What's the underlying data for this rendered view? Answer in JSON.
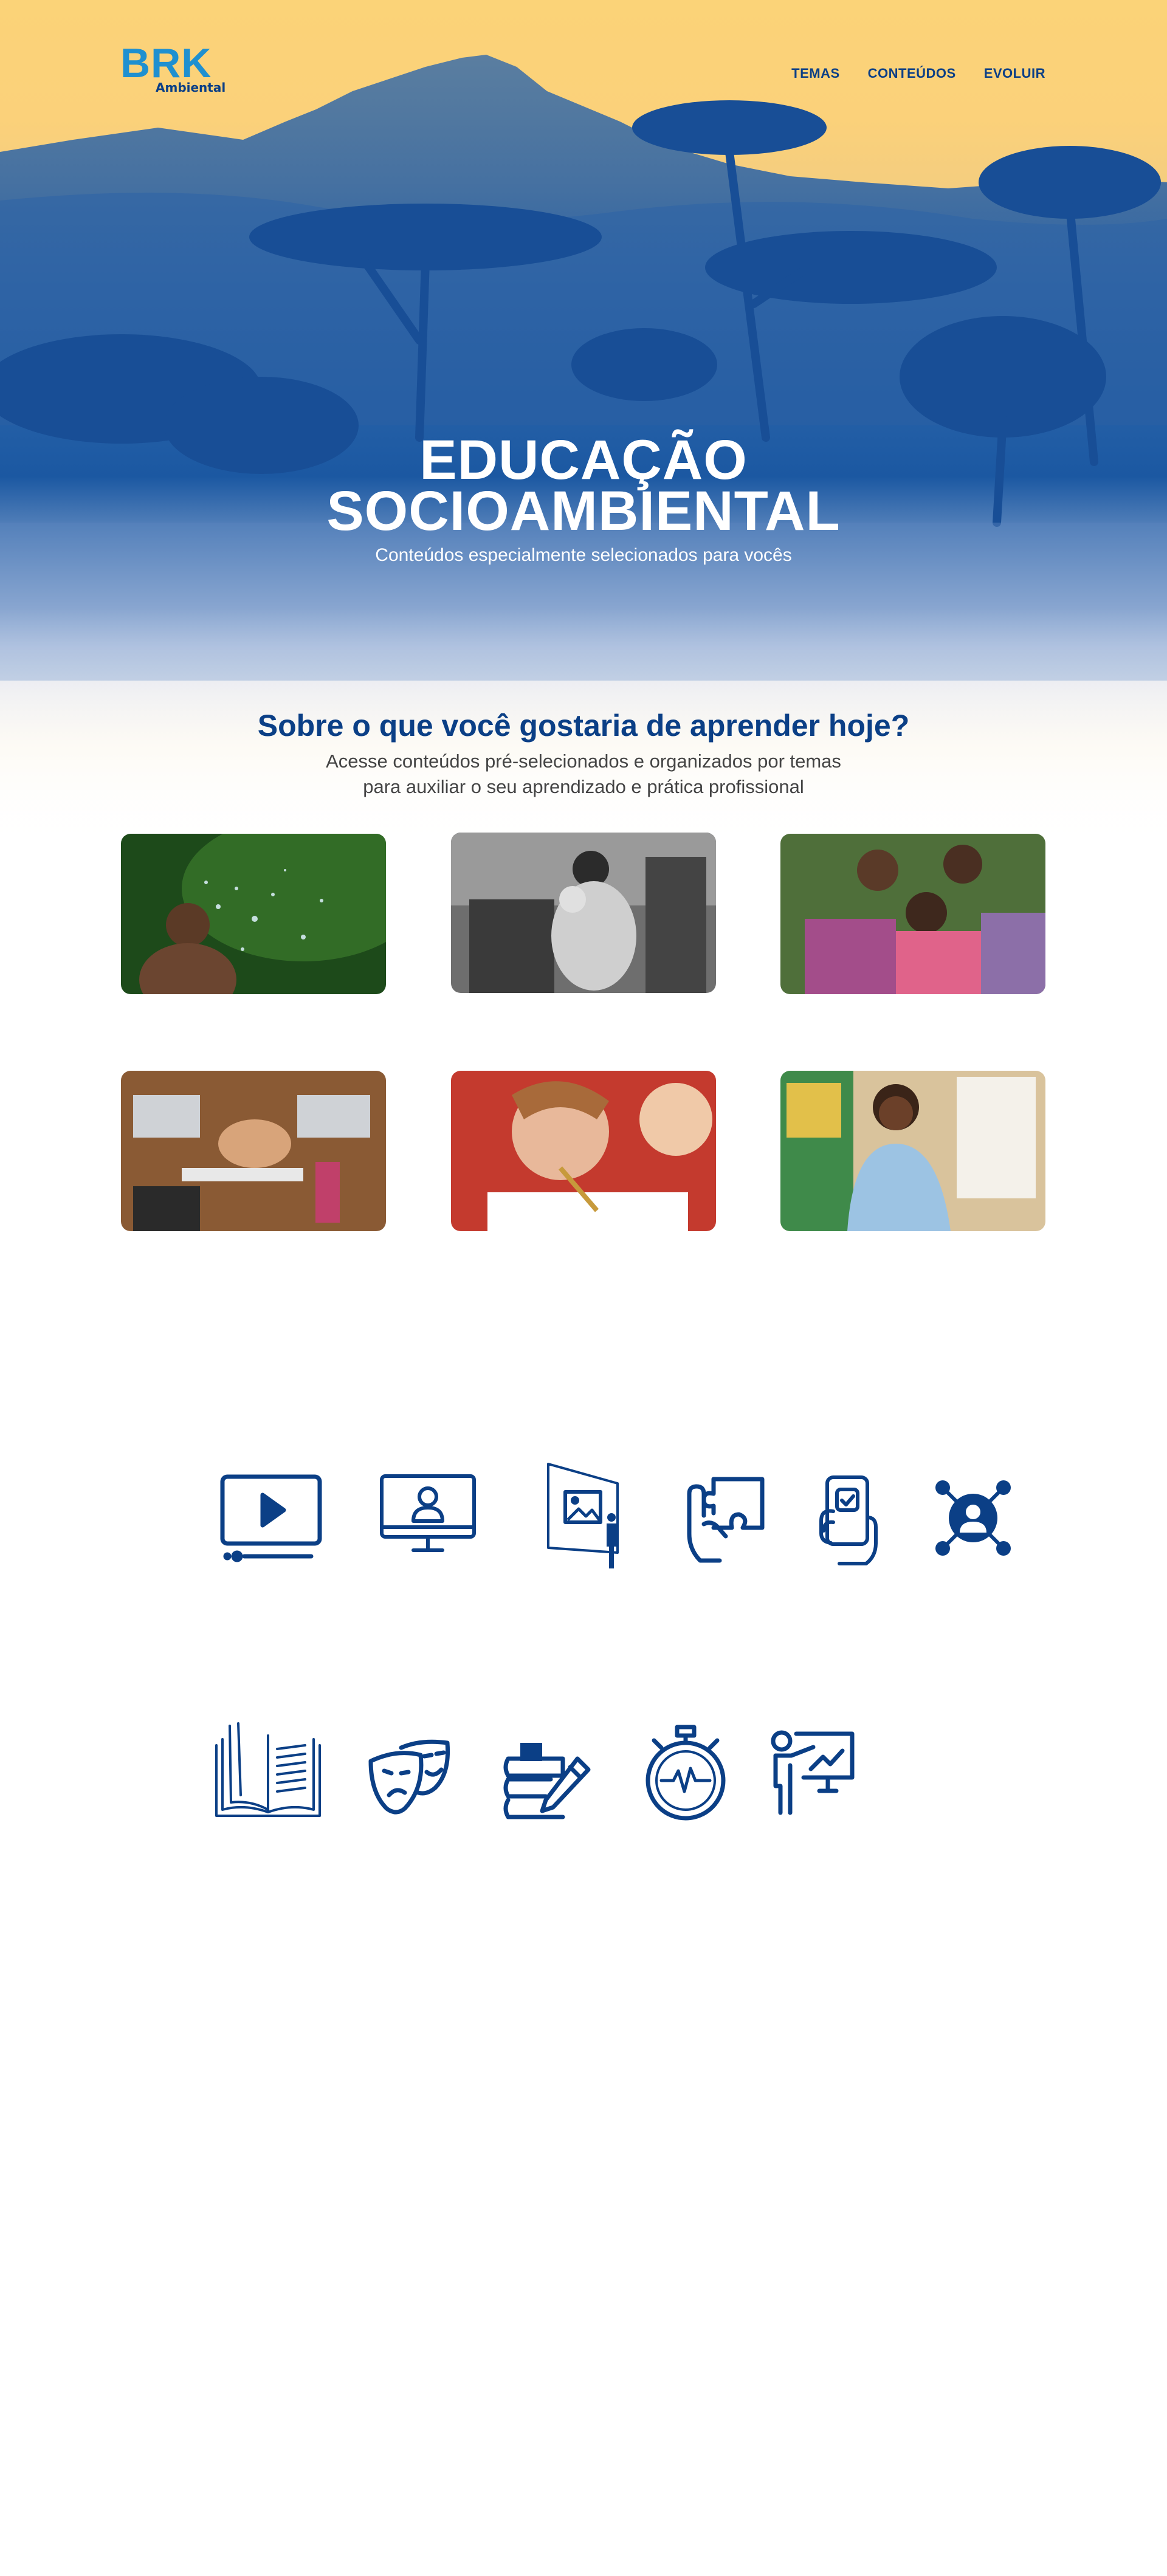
{
  "brand": {
    "logo_text": "BRK",
    "logo_sub": "Ambiental"
  },
  "nav": {
    "items": [
      {
        "label": "TEMAS"
      },
      {
        "label": "CONTEÚDOS"
      },
      {
        "label": "EVOLUIR"
      }
    ]
  },
  "hero": {
    "title_line1": "EDUCAÇÃO",
    "title_line2": "SOCIOAMBIENTAL",
    "subtitle": "Conteúdos especialmente selecionados para vocês"
  },
  "topics": {
    "title": "Sobre o que você gostaria de aprender hoje?",
    "subtitle_line1": "Acesse conteúdos pré-selecionados e organizados por temas",
    "subtitle_line2": "para auxiliar o seu aprendizado e prática profissional"
  },
  "cards": [
    {
      "image": "child-splashing-water"
    },
    {
      "image": "mother-child-washing-hands"
    },
    {
      "image": "children-hugging"
    },
    {
      "image": "team-hands-together-laptops"
    },
    {
      "image": "children-drawing"
    },
    {
      "image": "teacher-at-whiteboard"
    }
  ],
  "content_icons_row1": [
    "video-player-icon",
    "online-class-icon",
    "exhibition-icon",
    "puzzle-touch-icon",
    "mobile-check-icon",
    "network-user-icon"
  ],
  "content_icons_row2": [
    "open-book-icon",
    "theater-masks-icon",
    "books-pencil-icon",
    "stopwatch-icon",
    "presentation-icon"
  ],
  "colors": {
    "brand_blue": "#0b3f86",
    "logo_blue": "#1f90d0",
    "hero_yellow": "#fbd378"
  }
}
